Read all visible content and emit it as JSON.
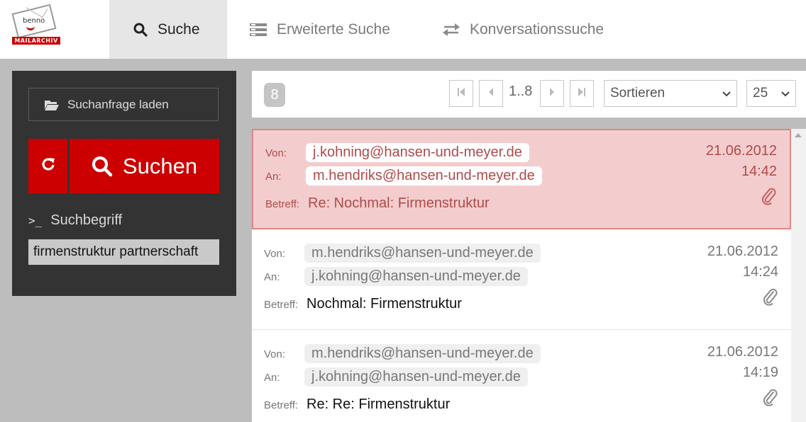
{
  "nav": {
    "logo_text": "benno",
    "logo_band": "MAILARCHIV",
    "tabs": [
      {
        "label": "Suche",
        "icon": "search-icon",
        "active": true
      },
      {
        "label": "Erweiterte Suche",
        "icon": "list-icon",
        "active": false
      },
      {
        "label": "Konversationssuche",
        "icon": "swap-icon",
        "active": false
      }
    ]
  },
  "sidebar": {
    "load_label": "Suchanfrage laden",
    "search_label": "Suchen",
    "term_label": "Suchbegriff",
    "term_prompt": ">_",
    "term_value": "firmenstruktur partnerschaft"
  },
  "toolbar": {
    "count": "8",
    "page_range": "1..8",
    "sort_label": "Sortieren",
    "per_page": "25"
  },
  "messages": [
    {
      "from_label": "Von:",
      "to_label": "An:",
      "subject_label": "Betreff:",
      "from": "j.kohning@hansen-und-meyer.de",
      "to": "m.hendriks@hansen-und-meyer.de",
      "subject": "Re: Nochmal: Firmenstruktur",
      "date": "21.06.2012",
      "time": "14:42",
      "selected": true
    },
    {
      "from_label": "Von:",
      "to_label": "An:",
      "subject_label": "Betreff:",
      "from": "m.hendriks@hansen-und-meyer.de",
      "to": "j.kohning@hansen-und-meyer.de",
      "subject": "Nochmal: Firmenstruktur",
      "date": "21.06.2012",
      "time": "14:24",
      "selected": false
    },
    {
      "from_label": "Von:",
      "to_label": "An:",
      "subject_label": "Betreff:",
      "from": "m.hendriks@hansen-und-meyer.de",
      "to": "j.kohning@hansen-und-meyer.de",
      "subject": "Re: Re: Firmenstruktur",
      "date": "21.06.2012",
      "time": "14:19",
      "selected": false
    }
  ],
  "colors": {
    "accent": "#cc0000",
    "selected_bg": "#f3cdce",
    "sidebar_bg": "#333333"
  }
}
